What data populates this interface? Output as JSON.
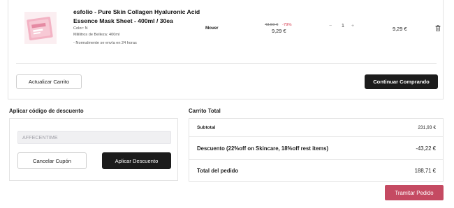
{
  "cart": {
    "item": {
      "title": "esfolio - Pure Skin Collagen Hyaluronic Acid Essence Mask Sheet - 400ml / 30ea",
      "color_line": "Color: N",
      "ml_line": "Mililitros de Belleza: 400ml",
      "shipping_note": "- Normalmente se envía en 24 horas",
      "move_label": "Mover",
      "old_price": "43,50 €",
      "discount": "-79%",
      "price": "9,29 €",
      "qty_minus": "−",
      "quantity": "1",
      "qty_plus": "+",
      "line_total": "9,29 €"
    },
    "update_button": "Actualizar Carrito",
    "continue_button": "Continuar Comprando"
  },
  "coupon": {
    "heading": "Aplicar código de descuento",
    "value": "AFFECENTIME",
    "cancel_button": "Cancelar Cupón",
    "apply_button": "Aplicar Descuento"
  },
  "totals": {
    "heading": "Carrito Total",
    "subtotal_label": "Subtotal",
    "subtotal_value": "231,93 €",
    "discount_label": "Descuento (22%off on Skincare, 18%off rest items)",
    "discount_value": "-43,22 €",
    "order_total_label": "Total del pedido",
    "order_total_value": "188,71 €",
    "checkout_button": "Tramitar Pedido"
  },
  "colors": {
    "accent": "#c54a62",
    "dark_button": "#1c1c1c",
    "discount_text": "#d6394e"
  }
}
